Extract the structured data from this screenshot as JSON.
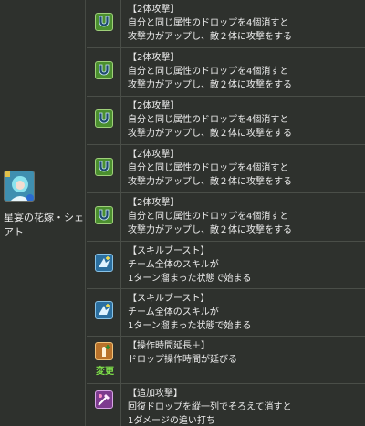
{
  "character": {
    "name": "星宴の花嫁・シェアト",
    "portrait_icon": "character-portrait-icon"
  },
  "rows": [
    {
      "icon": "two-attack-magnet-icon",
      "title": "【2体攻撃】",
      "line1": "自分と同じ属性のドロップを4個消すと",
      "line2": "攻撃力がアップし、敵２体に攻撃をする"
    },
    {
      "icon": "two-attack-magnet-icon",
      "title": "【2体攻撃】",
      "line1": "自分と同じ属性のドロップを4個消すと",
      "line2": "攻撃力がアップし、敵２体に攻撃をする"
    },
    {
      "icon": "two-attack-magnet-icon",
      "title": "【2体攻撃】",
      "line1": "自分と同じ属性のドロップを4個消すと",
      "line2": "攻撃力がアップし、敵２体に攻撃をする"
    },
    {
      "icon": "two-attack-magnet-icon",
      "title": "【2体攻撃】",
      "line1": "自分と同じ属性のドロップを4個消すと",
      "line2": "攻撃力がアップし、敵２体に攻撃をする"
    },
    {
      "icon": "two-attack-magnet-icon",
      "title": "【2体攻撃】",
      "line1": "自分と同じ属性のドロップを4個消すと",
      "line2": "攻撃力がアップし、敵２体に攻撃をする"
    },
    {
      "icon": "skill-boost-icon",
      "title": "【スキルブースト】",
      "line1": "チーム全体のスキルが",
      "line2": "1ターン溜まった状態で始まる"
    },
    {
      "icon": "skill-boost-icon",
      "title": "【スキルブースト】",
      "line1": "チーム全体のスキルが",
      "line2": "1ターン溜まった状態で始まる"
    },
    {
      "icon": "extend-time-icon",
      "title": "【操作時間延長＋】",
      "line1": "ドロップ操作時間が延びる",
      "line2": "",
      "change_label": "変更"
    },
    {
      "icon": "bonus-attack-icon",
      "title": "【追加攻撃】",
      "line1": "回復ドロップを縦一列でそろえて消すと",
      "line2": "1ダメージの追い打ち"
    }
  ]
}
